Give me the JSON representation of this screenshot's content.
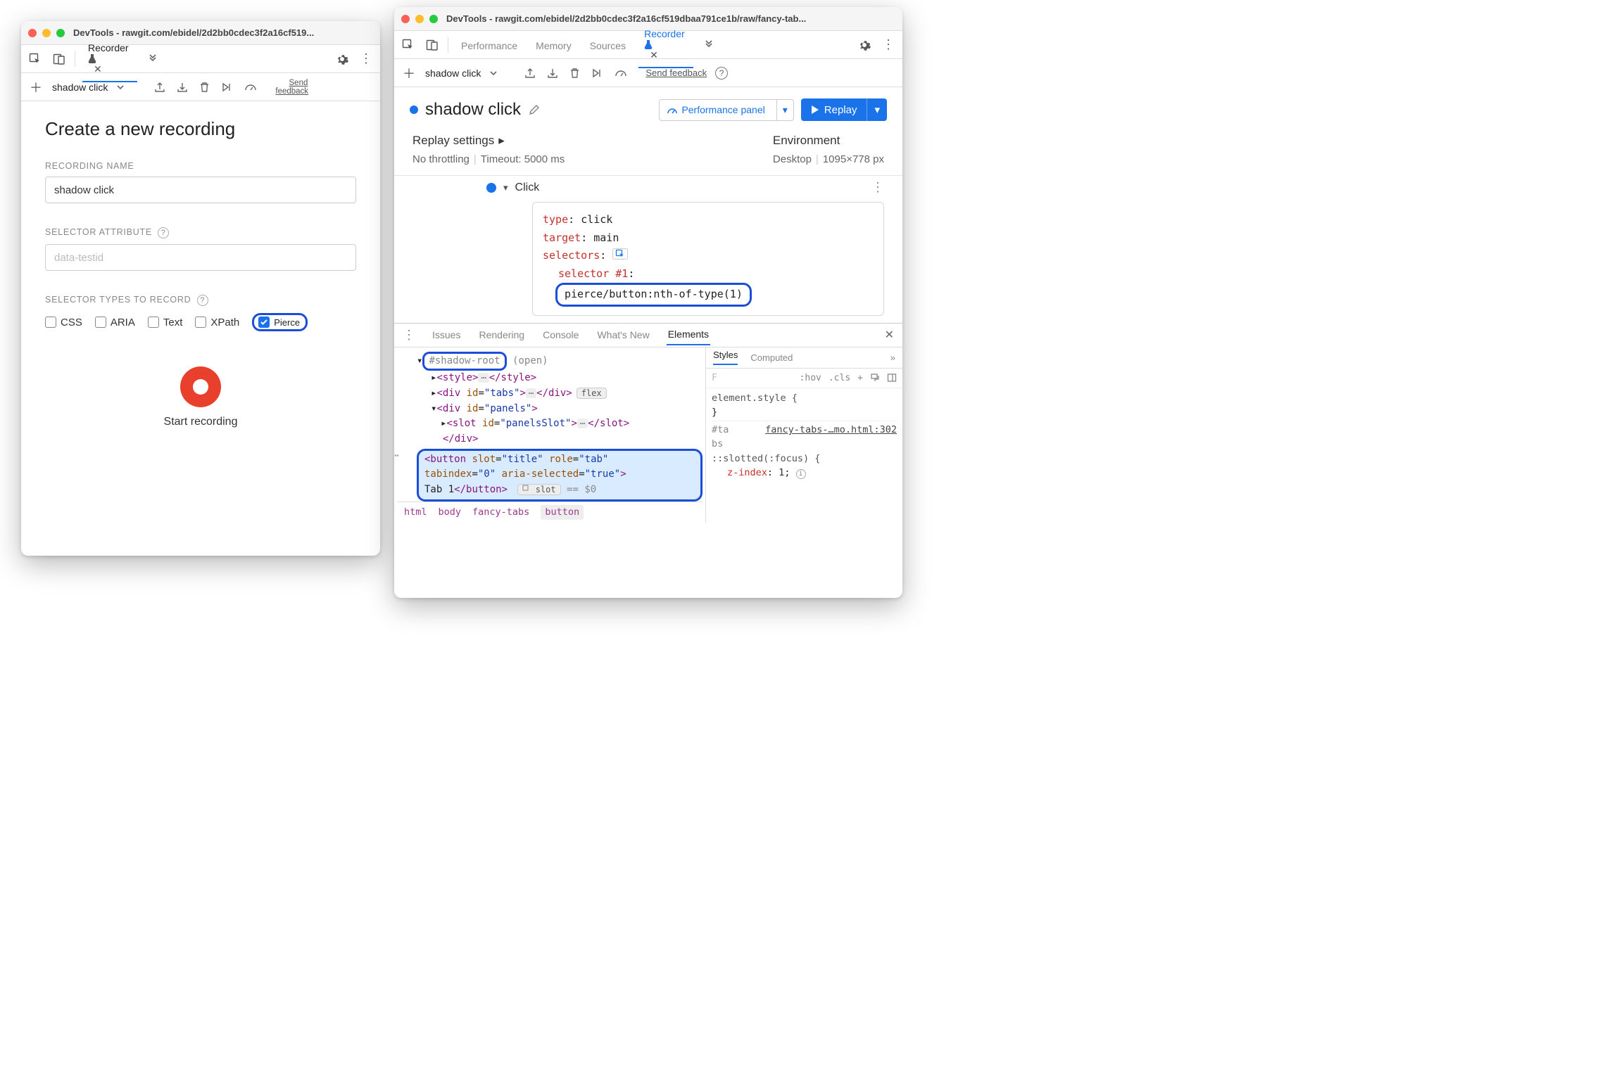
{
  "windows": {
    "left": {
      "title": "DevTools - rawgit.com/ebidel/2d2bb0cdec3f2a16cf519..."
    },
    "right": {
      "title": "DevTools - rawgit.com/ebidel/2d2bb0cdec3f2a16cf519dbaa791ce1b/raw/fancy-tab..."
    }
  },
  "left": {
    "tabs": {
      "recorder": "Recorder"
    },
    "secondbar": {
      "name": "shadow click",
      "send_feedback": "Send feedback"
    },
    "create": {
      "heading": "Create a new recording",
      "name_label": "RECORDING NAME",
      "name_value": "shadow click",
      "selector_attr_label": "SELECTOR ATTRIBUTE",
      "selector_attr_placeholder": "data-testid",
      "selector_types_label": "SELECTOR TYPES TO RECORD",
      "types": {
        "css": "CSS",
        "aria": "ARIA",
        "text": "Text",
        "xpath": "XPath",
        "pierce": "Pierce"
      },
      "start_label": "Start recording"
    }
  },
  "right": {
    "tabs": {
      "performance": "Performance",
      "memory": "Memory",
      "sources": "Sources",
      "recorder": "Recorder"
    },
    "secondbar": {
      "name": "shadow click",
      "send_feedback": "Send feedback"
    },
    "header": {
      "title": "shadow click",
      "perf_panel": "Performance panel",
      "replay": "Replay"
    },
    "settings": {
      "replay_head": "Replay settings",
      "throttling": "No throttling",
      "timeout": "Timeout: 5000 ms",
      "env_head": "Environment",
      "device": "Desktop",
      "dims": "1095×778 px"
    },
    "step": {
      "name": "Click",
      "card": {
        "type_k": "type",
        "type_v": "click",
        "target_k": "target",
        "target_v": "main",
        "selectors_k": "selectors",
        "sel1_k": "selector #1",
        "sel1_v": "pierce/button:nth-of-type(1)"
      }
    },
    "drawer": {
      "tabs": {
        "issues": "Issues",
        "rendering": "Rendering",
        "console": "Console",
        "whatsnew": "What's New",
        "elements": "Elements"
      },
      "dom": {
        "shadow_root": "#shadow-root",
        "open": "(open)",
        "style_open": "<style>",
        "style_close": "</style>",
        "tabs_open": "<div id=\"tabs\">",
        "div_close": "</div>",
        "panels_open": "<div id=\"panels\">",
        "slot_open": "<slot id=\"panelsSlot\">",
        "slot_close": "</slot>",
        "btn_l1": "<button slot=\"title\" role=\"tab\"",
        "btn_l2": "tabindex=\"0\" aria-selected=\"true\">",
        "btn_text": "Tab 1",
        "btn_close": "</button>",
        "slot_chip": "slot",
        "eq0": " == $0",
        "flex": "flex"
      },
      "crumbs": {
        "c1": "html",
        "c2": "body",
        "c3": "fancy-tabs",
        "c4": "button"
      },
      "styles": {
        "tabs": {
          "styles": "Styles",
          "computed": "Computed"
        },
        "filter_placeholder": "F",
        "hov": ":hov",
        "cls": ".cls",
        "elstyle": "element.style {",
        "brace": "}",
        "tasel": "#ta\nbs",
        "srclink": "fancy-tabs-…mo.html:302",
        "slotted": "::slotted(:focus) {",
        "zidx_k": "z-index",
        "zidx_v": "1"
      }
    }
  }
}
